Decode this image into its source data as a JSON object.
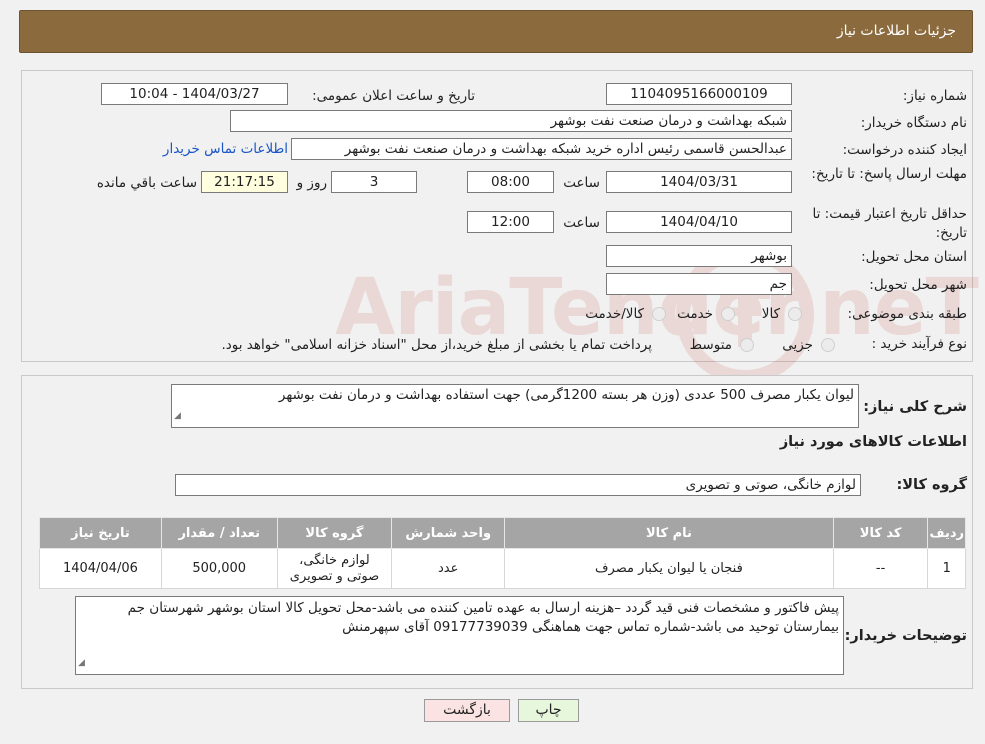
{
  "header": {
    "title": "جزئیات اطلاعات نیاز"
  },
  "details": {
    "need_number_label": "شماره نیاز:",
    "need_number": "1104095166000109",
    "announce_label": "تاریخ و ساعت اعلان عمومی:",
    "announce_value": "1404/03/27 - 10:04",
    "buyer_org_label": "نام دستگاه خریدار:",
    "buyer_org": "شبکه بهداشت و درمان صنعت نفت بوشهر",
    "requester_label": "ایجاد کننده درخواست:",
    "requester": "عبدالحسن قاسمی رئیس اداره خرید  شبکه بهداشت و درمان صنعت نفت بوشهر",
    "contact_link": "اطلاعات تماس خریدار",
    "deadline_label": "مهلت ارسال پاسخ: تا تاریخ:",
    "deadline_date": "1404/03/31",
    "time_label": "ساعت",
    "deadline_time": "08:00",
    "days_value": "3",
    "days_label": "روز و",
    "remaining_time": "21:17:15",
    "remaining_label": "ساعت باقي مانده",
    "validity_label": "حداقل تاريخ اعتبار قيمت: تا تاریخ:",
    "validity_date": "1404/04/10",
    "validity_time": "12:00",
    "province_label": "استان محل تحویل:",
    "province": "بوشهر",
    "city_label": "شهر محل تحویل:",
    "city": "جم",
    "category_label": "طبقه بندی موضوعی:",
    "category_options": [
      "کالا",
      "خدمت",
      "کالا/خدمت"
    ],
    "process_label": "نوع فرآیند خرید :",
    "process_options": [
      "جزیی",
      "متوسط"
    ],
    "process_note": "پرداخت تمام یا بخشی از مبلغ خرید،از محل \"اسناد خزانه اسلامی\" خواهد بود."
  },
  "summary": {
    "desc_label": "شرح کلی نیاز:",
    "desc_value": "لیوان یکبار مصرف 500 عددی (وزن هر بسته 1200گرمی) جهت استفاده بهداشت و درمان نفت بوشهر",
    "goods_info_title": "اطلاعات کالاهای مورد نیاز",
    "group_label": "گروه کالا:",
    "group_value": "لوازم خانگی، صوتی و تصویری"
  },
  "table": {
    "headers": [
      "ردیف",
      "کد کالا",
      "نام کالا",
      "واحد شمارش",
      "گروه کالا",
      "تعداد / مقدار",
      "تاریخ نیاز"
    ],
    "rows": [
      [
        "1",
        "--",
        "فنجان یا لیوان یکبار مصرف",
        "عدد",
        "لوازم خانگی، صوتی و تصویری",
        "500,000",
        "1404/04/06"
      ]
    ]
  },
  "buyer_notes": {
    "label": "توضیحات خریدار:",
    "text": "پیش فاکتور و مشخصات فنی قید گردد –هزینه ارسال به عهده تامین کننده می باشد-محل تحویل کالا استان بوشهر شهرستان جم بیمارستان توحید می باشد-شماره تماس جهت هماهنگی 09177739039 آقای سپهرمنش"
  },
  "buttons": {
    "print": "چاپ",
    "back": "بازگشت"
  },
  "colors": {
    "header_bg": "#8b6a3e",
    "table_header_bg": "#a5a5a5",
    "print_btn_bg": "#e6f7dc",
    "back_btn_bg": "#fbe3e3",
    "link": "#1a55c8"
  },
  "watermark": "AriaTender.neT"
}
